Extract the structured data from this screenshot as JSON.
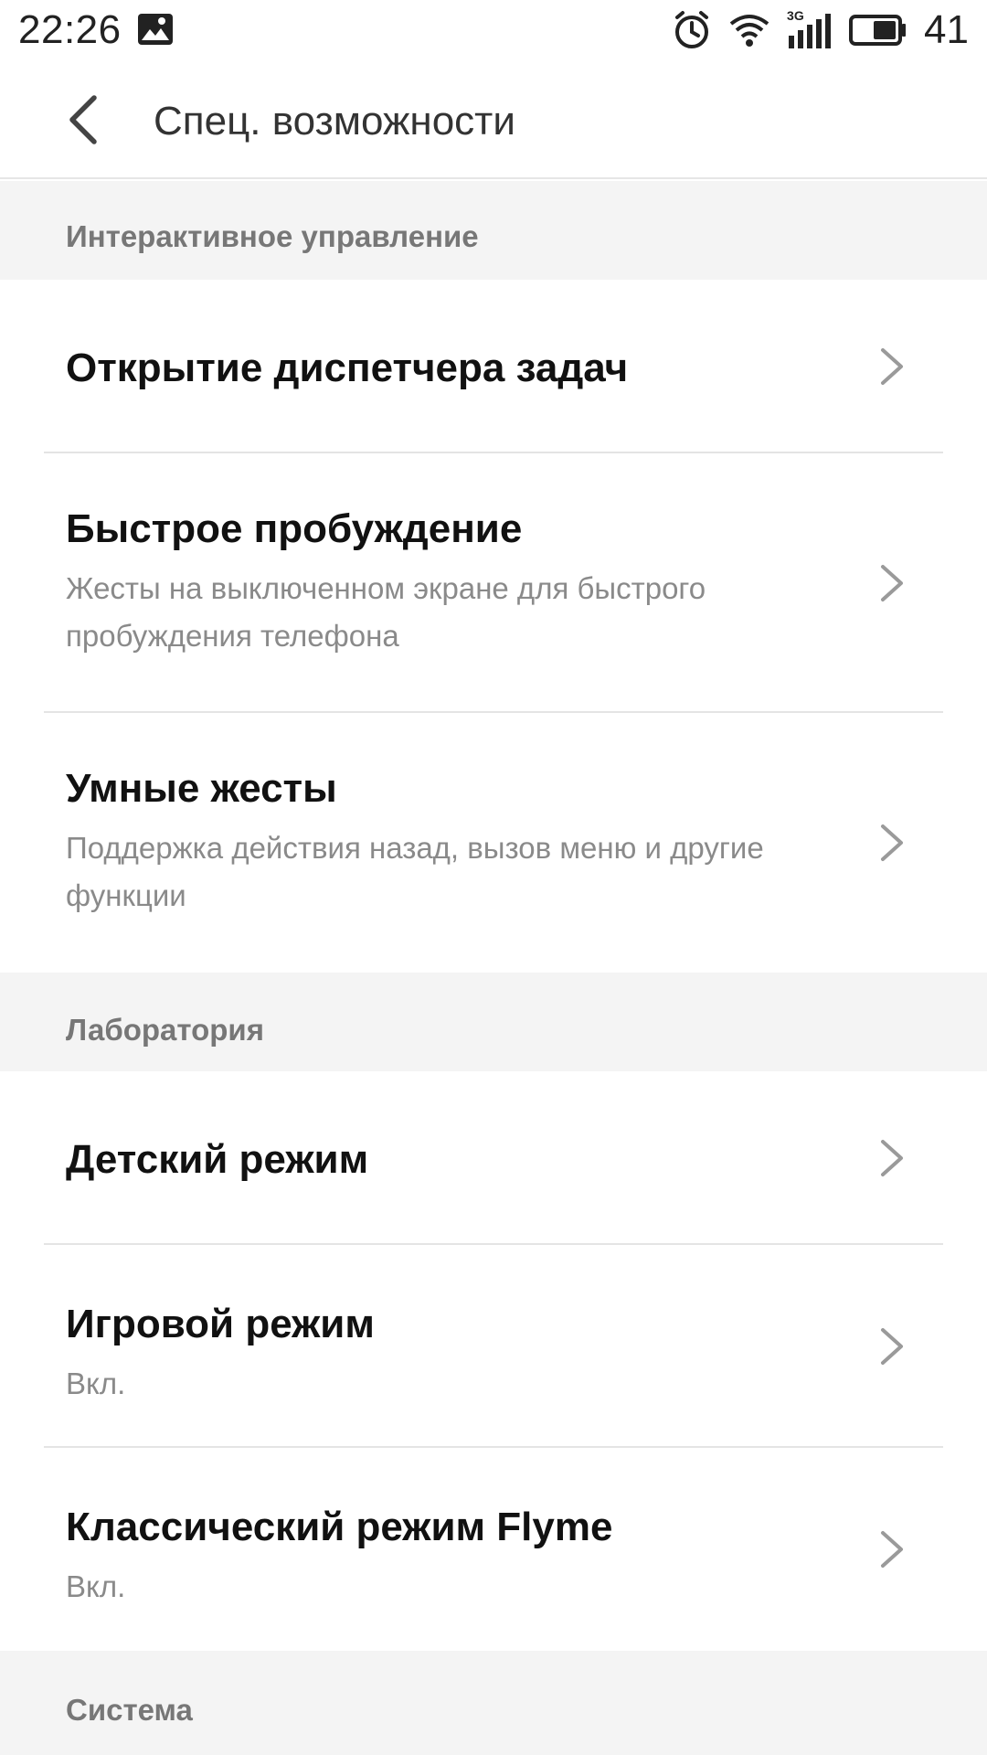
{
  "status_bar": {
    "time": "22:26",
    "network": "3G",
    "battery": "41",
    "icons": [
      "gallery-icon",
      "alarm-icon",
      "wifi-icon",
      "signal-icon",
      "battery-icon"
    ]
  },
  "header": {
    "title": "Спец. возможности",
    "back_icon": "back-arrow-icon"
  },
  "sections": [
    {
      "title": "Интерактивное управление",
      "items": [
        {
          "title": "Открытие диспетчера задач",
          "subtitle": ""
        },
        {
          "title": "Быстрое пробуждение",
          "subtitle": "Жесты на выключенном экране для быстрого пробуждения телефона"
        },
        {
          "title": "Умные жесты",
          "subtitle": "Поддержка действия назад, вызов меню и другие функции"
        }
      ]
    },
    {
      "title": "Лаборатория",
      "items": [
        {
          "title": "Детский режим",
          "subtitle": ""
        },
        {
          "title": "Игровой режим",
          "subtitle": "Вкл."
        },
        {
          "title": "Классический режим Flyme",
          "subtitle": "Вкл."
        }
      ]
    },
    {
      "title": "Система",
      "items": []
    }
  ],
  "colors": {
    "section_bg": "#f4f4f4",
    "title_text": "#111111",
    "subtitle_text": "#8a8a8a",
    "chevron": "#9a9a9a"
  }
}
